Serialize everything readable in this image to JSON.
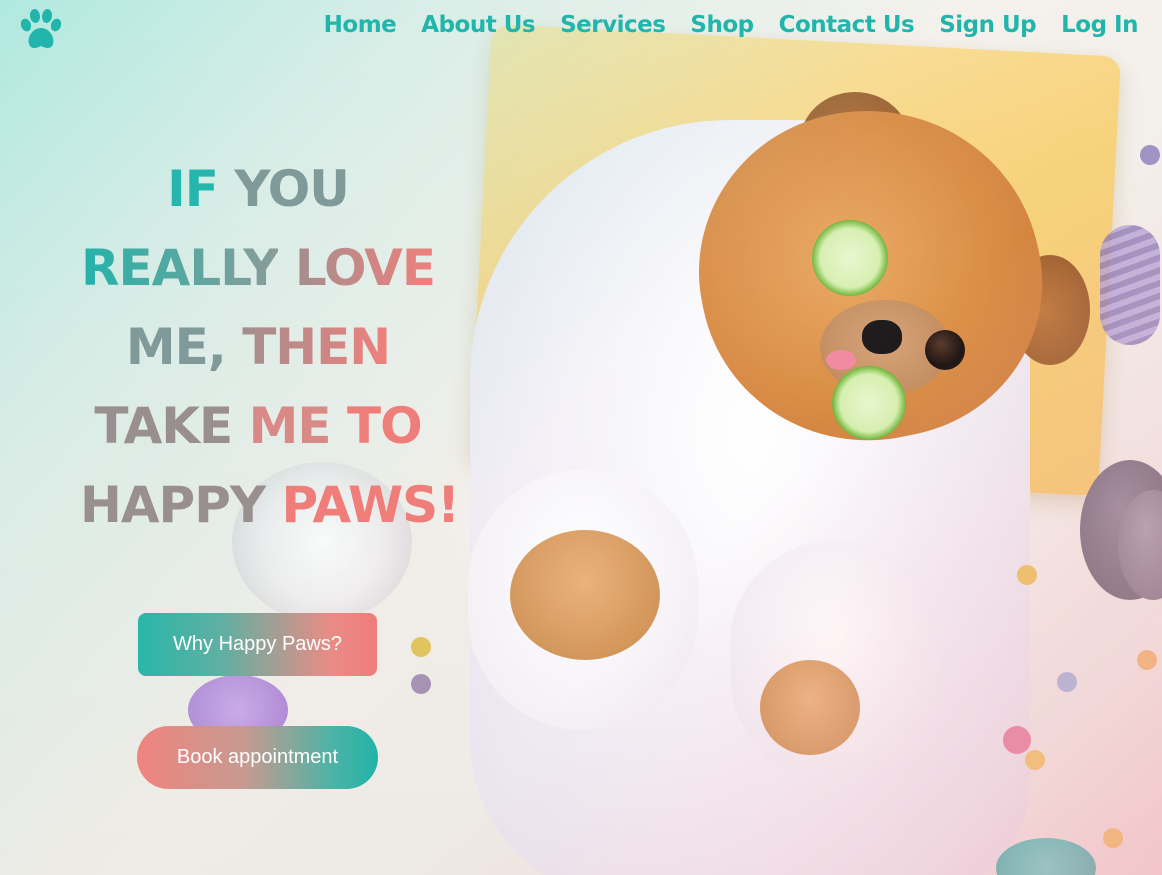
{
  "brand": {
    "logo_icon": "paw-icon",
    "accent_color": "#22b5ab",
    "pink_color": "#f07c7c"
  },
  "nav": {
    "items": [
      {
        "label": "Home"
      },
      {
        "label": "About Us"
      },
      {
        "label": "Services"
      },
      {
        "label": "Shop"
      },
      {
        "label": "Contact Us"
      },
      {
        "label": "Sign Up"
      },
      {
        "label": "Log In"
      }
    ]
  },
  "hero": {
    "lines": [
      [
        "IF",
        "YOU"
      ],
      [
        "REALLY",
        "LOVE"
      ],
      [
        "ME,",
        "THEN"
      ],
      [
        "TAKE",
        "ME",
        "TO"
      ],
      [
        "HAPPY",
        "PAWS!"
      ]
    ]
  },
  "buttons": {
    "why_label": "Why Happy Paws?",
    "book_label": "Book appointment"
  }
}
